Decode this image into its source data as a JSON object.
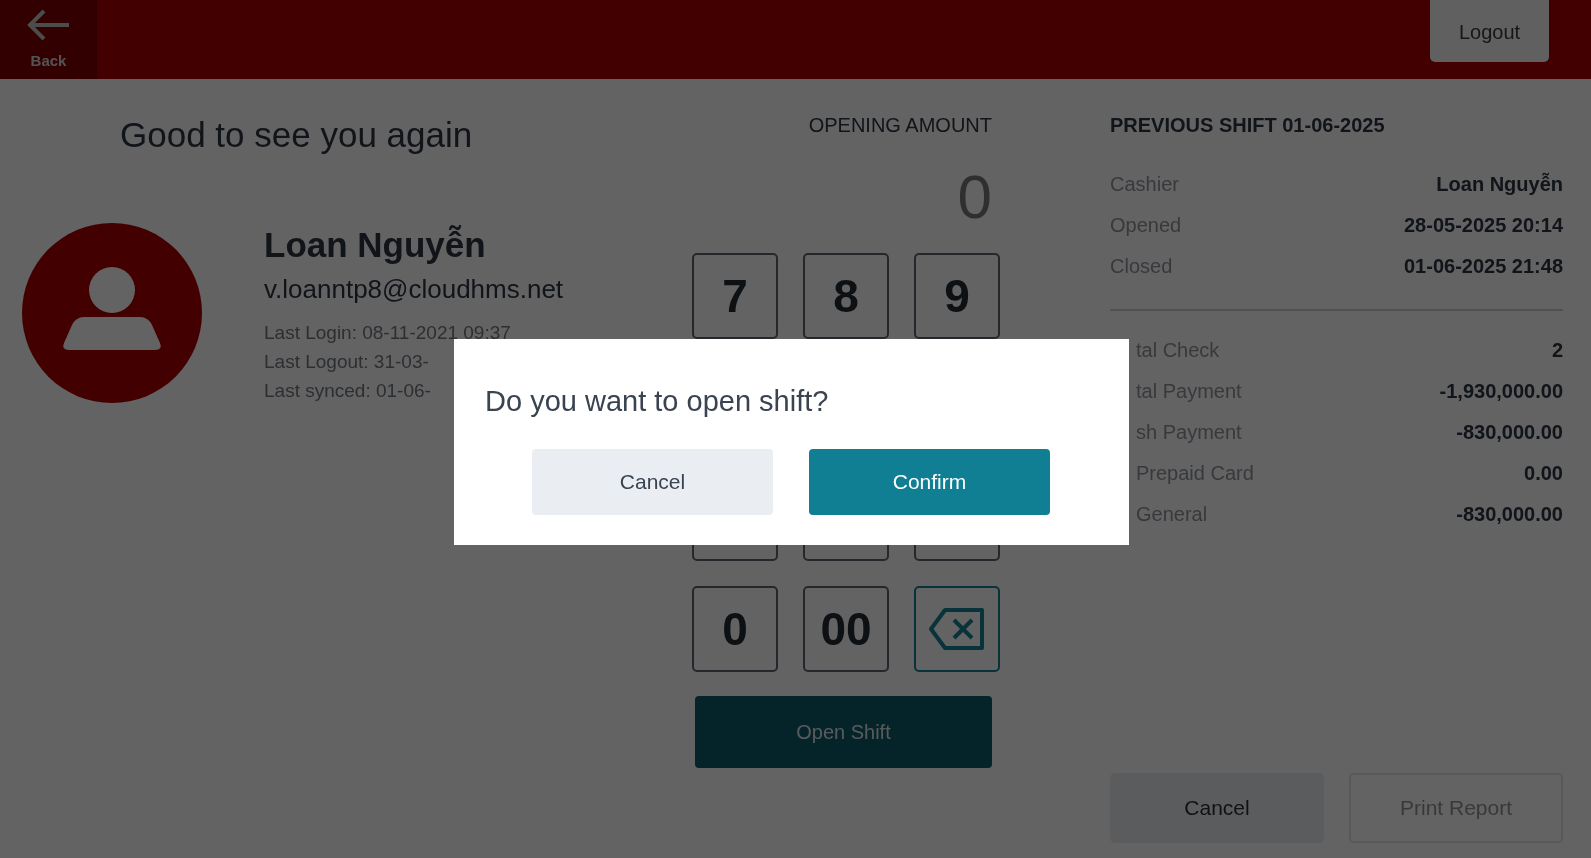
{
  "header": {
    "back_label": "Back",
    "logout_label": "Logout"
  },
  "greeting": "Good to see you again",
  "profile": {
    "name": "Loan Nguyễn",
    "email": "v.loanntp8@cloudhms.net",
    "details": [
      "Last Login: 08-11-2021 09:37",
      "Last Logout: 31-03-",
      "Last synced: 01-06-"
    ]
  },
  "opening_amount": {
    "label": "OPENING AMOUNT",
    "value": "0"
  },
  "keypad": {
    "top_row": [
      "7",
      "8",
      "9"
    ],
    "bottom_row": [
      {
        "kind": "digit",
        "label": "0"
      },
      {
        "kind": "digit",
        "label": "00"
      },
      {
        "kind": "backspace"
      }
    ]
  },
  "open_shift_button": "Open Shift",
  "previous_shift": {
    "title": "PREVIOUS SHIFT 01-06-2025",
    "info": [
      {
        "label": "Cashier",
        "value": "Loan Nguyễn"
      },
      {
        "label": "Opened",
        "value": "28-05-2025 20:14"
      },
      {
        "label": "Closed",
        "value": "01-06-2025 21:48"
      }
    ],
    "totals": [
      {
        "label": "tal Check",
        "value": "2"
      },
      {
        "label": "tal Payment",
        "value": "-1,930,000.00"
      },
      {
        "label": "sh Payment",
        "value": "-830,000.00"
      },
      {
        "label": "Prepaid Card",
        "value": "0.00"
      },
      {
        "label": "General",
        "value": "-830,000.00"
      }
    ],
    "buttons": [
      {
        "label": "Cancel",
        "disabled": false
      },
      {
        "label": "Print Report",
        "disabled": true
      }
    ]
  },
  "dialog": {
    "question": "Do you want to open shift?",
    "buttons": [
      {
        "label": "Cancel",
        "kind": "secondary"
      },
      {
        "label": "Confirm",
        "kind": "primary"
      }
    ]
  }
}
